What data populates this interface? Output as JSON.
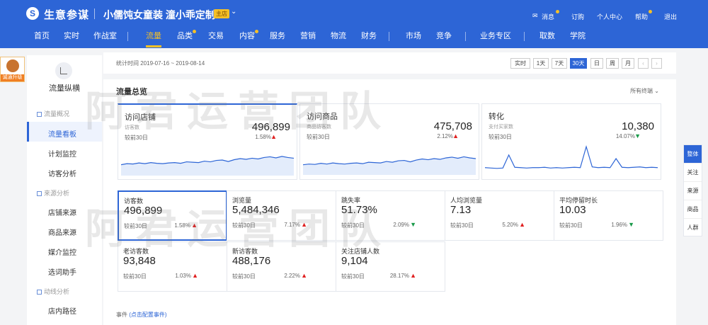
{
  "header": {
    "logo_glyph": "S",
    "brand": "生意参谋",
    "shop_name": "小儒饨女童装 潼小乖定制",
    "shop_badge": "主店",
    "links": [
      "消息",
      "订购",
      "个人中心",
      "帮助",
      "退出"
    ]
  },
  "nav": {
    "items": [
      "首页",
      "实时",
      "作战室",
      "流量",
      "品类",
      "交易",
      "内容",
      "服务",
      "营销",
      "物流",
      "财务",
      "市场",
      "竞争",
      "业务专区",
      "取数",
      "学院"
    ],
    "active": "流量"
  },
  "sidebar": {
    "badge": "诚通升级",
    "title": "流量纵横",
    "groups": [
      {
        "label": "流量概况",
        "items": [
          "流量看板",
          "计划监控",
          "访客分析"
        ]
      },
      {
        "label": "来源分析",
        "items": [
          "店铺来源",
          "商品来源",
          "媒介监控",
          "选词助手"
        ]
      },
      {
        "label": "动线分析",
        "items": [
          "店内路径"
        ]
      }
    ],
    "active_item": "流量看板"
  },
  "date_bar": {
    "text": "统计时间 2019-07-16 ~ 2019-08-14",
    "ranges": [
      "实时",
      "1天",
      "7天",
      "30天",
      "日",
      "周",
      "月"
    ],
    "active_range": "30天",
    "prev": "‹",
    "next": "›"
  },
  "overview": {
    "title": "流量总览",
    "terminal": "所有终端"
  },
  "big_cards": [
    {
      "title": "访问店铺",
      "sub": "访客数",
      "value": "496,899",
      "compare": "较前30日",
      "pct": "1.58%",
      "trend": "up",
      "series": [
        30,
        33,
        32,
        35,
        33,
        36,
        34,
        33,
        35,
        36,
        34,
        38,
        37,
        36,
        40,
        38,
        42,
        43,
        39,
        44,
        47,
        45,
        48,
        46,
        50,
        52,
        49,
        53,
        50,
        48
      ]
    },
    {
      "title": "访问商品",
      "sub": "商品访客数",
      "value": "475,708",
      "compare": "较前30日",
      "pct": "2.12%",
      "trend": "up",
      "series": [
        28,
        30,
        29,
        32,
        30,
        33,
        31,
        30,
        32,
        33,
        31,
        35,
        34,
        33,
        37,
        35,
        39,
        40,
        36,
        41,
        44,
        42,
        45,
        43,
        47,
        49,
        46,
        50,
        47,
        45
      ]
    },
    {
      "title": "转化",
      "sub": "支付买家数",
      "value": "10,380",
      "compare": "较前30日",
      "pct": "14.07%",
      "trend": "down",
      "series": [
        20,
        19,
        18,
        19,
        55,
        21,
        20,
        19,
        20,
        20,
        21,
        19,
        20,
        19,
        20,
        21,
        20,
        78,
        22,
        20,
        21,
        20,
        45,
        21,
        20,
        21,
        22,
        20,
        21,
        20
      ]
    }
  ],
  "metrics": [
    {
      "title": "访客数",
      "value": "496,899",
      "compare": "较前30日",
      "pct": "1.58%",
      "trend": "up"
    },
    {
      "title": "浏览量",
      "value": "5,484,346",
      "compare": "较前30日",
      "pct": "7.17%",
      "trend": "up"
    },
    {
      "title": "跳失率",
      "value": "51.73%",
      "compare": "较前30日",
      "pct": "2.09%",
      "trend": "down"
    },
    {
      "title": "人均浏览量",
      "value": "7.13",
      "compare": "较前30日",
      "pct": "5.20%",
      "trend": "up"
    },
    {
      "title": "平均停留时长",
      "value": "10.03",
      "compare": "较前30日",
      "pct": "1.96%",
      "trend": "down"
    },
    {
      "title": "老访客数",
      "value": "93,848",
      "compare": "较前30日",
      "pct": "1.03%",
      "trend": "up"
    },
    {
      "title": "新访客数",
      "value": "488,176",
      "compare": "较前30日",
      "pct": "2.22%",
      "trend": "up"
    },
    {
      "title": "关注店铺人数",
      "value": "9,104",
      "compare": "较前30日",
      "pct": "28.17%",
      "trend": "up"
    }
  ],
  "events": {
    "label": "事件",
    "link": "(点击配置事件)"
  },
  "right_tabs": [
    "整体",
    "关注",
    "来源",
    "商品",
    "人群"
  ],
  "watermark": "阿君运营团队",
  "colors": {
    "primary": "#2d65d6",
    "accent": "#f5c026",
    "up": "#e02020",
    "down": "#1a9a4a"
  }
}
